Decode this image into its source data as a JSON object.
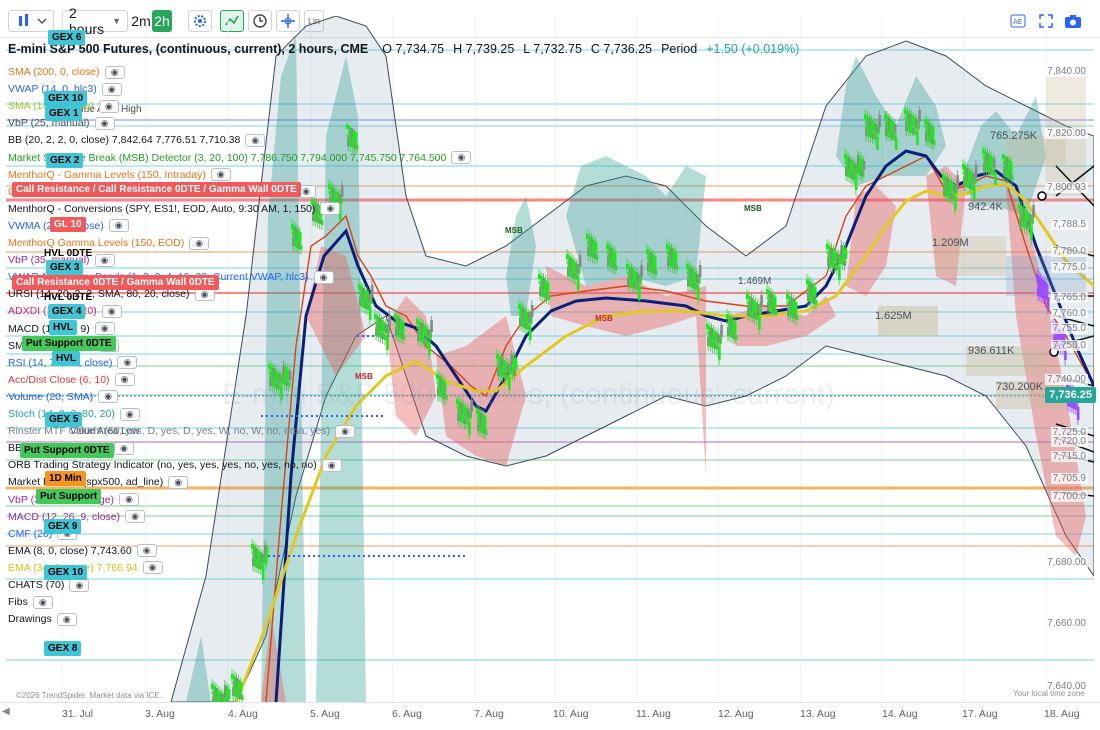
{
  "toolbar": {
    "interval": "2 hours",
    "ranges": [
      "2m",
      "2h"
    ],
    "lin_label": "Lin"
  },
  "legend": {
    "title": "E-mini S&P 500 Futures, (continuous, current), 2 hours, CME",
    "ohlc": [
      "O 7,734.75",
      "H 7,739.25",
      "L 7,732.75",
      "C 7,736.25"
    ],
    "period": "Period",
    "period_change": "+1.50 (+0.019%)",
    "watermark": "E-mini S&P 500 Futures, (continuous, current)",
    "indicators": [
      {
        "label": "SMA (200, 0, close)",
        "color": "#e8741a"
      },
      {
        "label": "VWAP (14, 0, hlc3)",
        "color": "#2962ff"
      },
      {
        "label": "SMA (14, 0, close)",
        "color": "#a6c520"
      },
      {
        "label": "VbP (25, manual)",
        "color": "#4a4f5c"
      },
      {
        "label": "BB (20, 2, 2, 0, close)   7,842.64  7,776.51  7,710.38",
        "color": "#131722"
      },
      {
        "label": "Market Structure Break (MSB) Detector (3, 20, 100)   7,786.750  7,794.000  7,745.750  7,764.500",
        "color": "#1ea01e"
      },
      {
        "label": "MenthorQ - Gamma Levels (150, Intraday)",
        "color": "#e8741a"
      },
      {
        "label": "Call Resistance / Call Resistance 0DTE / Gamma Wall 0DTE",
        "color": "#e8741a"
      },
      {
        "label": "MenthorQ - Conversions (SPY, ES1!, EOD, Auto, 9:30 AM, 1, 150)",
        "color": "#131722"
      },
      {
        "label": "VWMA (20, 0, close)",
        "color": "#2962ff"
      },
      {
        "label": "MenthorQ Gamma Levels (150, EOD)",
        "color": "#e8741a"
      },
      {
        "label": "VbP (35, manual)",
        "color": "#9c27b0"
      },
      {
        "label": "VWAP Auto Stdev Bands (1, 2, 3, 4, 10, 30, Current VWAP, hlc3)",
        "color": "#2962ff"
      },
      {
        "label": "URSI (14, 20, 2, 2, SMA, 80, 20, close)",
        "color": "#131722"
      },
      {
        "label": "ADXDI (14, 14, 20)",
        "color": "#e91e63"
      },
      {
        "label": "MACD (12, 26, 9)",
        "color": "#131722"
      },
      {
        "label": "SMA (20, 0, close)",
        "color": "#131722"
      },
      {
        "label": "RSI (14, 70, 30, close)",
        "color": "#2962ff"
      },
      {
        "label": "Acc/Dist Close (6, 10)",
        "color": "#e53935"
      },
      {
        "label": "Volume (20, SMA)",
        "color": "#2962ff"
      },
      {
        "label": "Stoch (14, 3, 3, 80, 20)",
        "color": "#26a69a"
      },
      {
        "label": "Rinster MTF Clouds (60, yes, D, yes, D, yes, W, no, W, no, ema, yes)",
        "color": "#7a7f8c"
      },
      {
        "label": "BB (20, 2, 2, 0, close)",
        "color": "#131722"
      },
      {
        "label": "ORB Trading Strategy Indicator (no, yes, yes, yes, no, yes, no, no)",
        "color": "#131722"
      },
      {
        "label": "Market Breadth (spx500, ad_line)",
        "color": "#131722"
      },
      {
        "label": "VbP (35, visible range)",
        "color": "#9c27b0"
      },
      {
        "label": "MACD (12, 26, 9, close)",
        "color": "#9c27b0"
      },
      {
        "label": "CMF (20)",
        "color": "#2962ff"
      },
      {
        "label": "EMA (8, 0, close)   7,743.60",
        "color": "#131722"
      },
      {
        "label": "EMA (34, 0, close)   7,766.94",
        "color": "#d4c21a"
      },
      {
        "label": "CHATS (70)",
        "color": "#131722"
      },
      {
        "label": "Fibs",
        "color": "#131722"
      },
      {
        "label": "Drawings",
        "color": "#131722"
      }
    ]
  },
  "tags": [
    {
      "text": "GEX 6",
      "kind": "teal"
    },
    {
      "text": "GEX 10",
      "kind": "teal"
    },
    {
      "text": "GEX 1",
      "kind": "teal"
    },
    {
      "text": "GEX 2",
      "kind": "teal"
    },
    {
      "text": "Call Resistance / Call Resistance 0DTE / Gamma Wall 0DTE",
      "kind": "red"
    },
    {
      "text": "GL 10",
      "kind": "red"
    },
    {
      "text": "HVL 0DTE",
      "kind": "plain"
    },
    {
      "text": "GEX 3",
      "kind": "teal"
    },
    {
      "text": "Call Resistance 0DTE / Gamma Wall 0DTE",
      "kind": "red"
    },
    {
      "text": "HVL 0DTE",
      "kind": "plain"
    },
    {
      "text": "GEX 4",
      "kind": "teal"
    },
    {
      "text": "HVL",
      "kind": "teal"
    },
    {
      "text": "Put Support 0DTE",
      "kind": "green"
    },
    {
      "text": "HVL",
      "kind": "teal"
    },
    {
      "text": "GEX 5",
      "kind": "teal"
    },
    {
      "text": "Put Support 0DTE",
      "kind": "green"
    },
    {
      "text": "1D Min",
      "kind": "orange"
    },
    {
      "text": "Put Support",
      "kind": "green"
    },
    {
      "text": "GEX 9",
      "kind": "teal"
    },
    {
      "text": "GEX 10",
      "kind": "teal"
    },
    {
      "text": "GEX 8",
      "kind": "teal"
    }
  ],
  "annotations": {
    "value_area_high": "Value Area High",
    "value_area_low": "Value Area Low",
    "msb": "MSB",
    "vp_labels": [
      "765.275K",
      "942.4K",
      "1.209M",
      "1.625M",
      "936.611K",
      "730.200K",
      "1.469M"
    ],
    "copyright": "©2026 TrendSpider. Market data via ICE.",
    "timezone": "Your local time zone"
  },
  "y_axis": {
    "labels": [
      "7,840.00",
      "7,820.00",
      "7,800.93",
      "7,788.5",
      "7,780.0",
      "7,775.0",
      "7,765.0",
      "7,760.0",
      "7,755.0",
      "7,750.0",
      "7,740.00",
      "7,725.0",
      "7,720.0",
      "7,715.0",
      "7,705.9",
      "7,700.0",
      "7,680.00",
      "7,660.00",
      "7,640.00"
    ],
    "current_price": "7,736.25"
  },
  "x_axis": {
    "labels": [
      "31. Jul",
      "3. Aug",
      "4. Aug",
      "5. Aug",
      "6. Aug",
      "7. Aug",
      "10. Aug",
      "11. Aug",
      "12. Aug",
      "13. Aug",
      "14. Aug",
      "17. Aug",
      "18. Aug"
    ]
  },
  "colors": {
    "up": "#1ee81e",
    "down": "#8a8a8a",
    "ema8": "#0a1f7a",
    "ema34": "#e3c823",
    "cloud_bull": "#2a9d8f",
    "cloud_bear": "#e85a5a",
    "accent": "#26a65b"
  }
}
